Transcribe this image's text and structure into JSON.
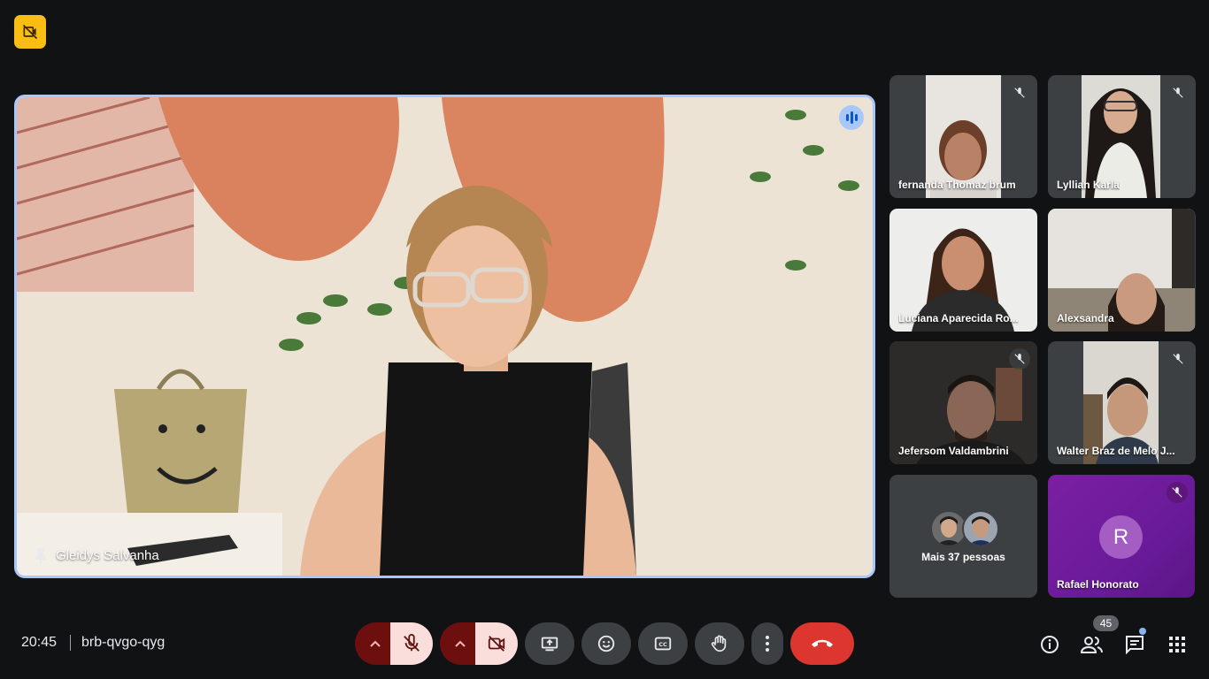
{
  "main_speaker": {
    "name": "Gleidys Salvanha"
  },
  "participants": [
    {
      "name": "fernanda Thomaz brum",
      "muted": true
    },
    {
      "name": "Lyllian Karla",
      "muted": true
    },
    {
      "name": "Luciana Aparecida Ro...",
      "muted": false
    },
    {
      "name": "Alexsandra",
      "muted": false
    },
    {
      "name": "Jefersom Valdambrini",
      "muted": true
    },
    {
      "name": "Walter Braz de Melo J...",
      "muted": true
    }
  ],
  "more_people": {
    "label": "Mais 37 pessoas"
  },
  "rafael": {
    "name": "Rafael Honorato",
    "initial": "R",
    "muted": true
  },
  "bottom_bar": {
    "time": "20:45",
    "meeting_code": "brb-qvgo-qyg",
    "participant_count": "45"
  },
  "colors": {
    "background": "#111214",
    "speaking_border": "#a8c7fa",
    "end_call": "#dc362e",
    "badge_yellow": "#f9bd14",
    "avatar_purple": "#a45dc3"
  }
}
